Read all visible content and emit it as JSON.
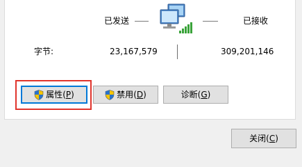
{
  "stats": {
    "sent_label": "已发送",
    "received_label": "已接收",
    "bytes_label": "字节:",
    "bytes_sent": "23,167,579",
    "bytes_received": "309,201,146"
  },
  "buttons": {
    "properties": {
      "label": "属性",
      "paren_open": "(",
      "accel": "P",
      "paren_close": ")"
    },
    "disable": {
      "label": "禁用",
      "paren_open": "(",
      "accel": "D",
      "paren_close": ")"
    },
    "diagnose": {
      "label": "诊断",
      "paren_open": "(",
      "accel": "G",
      "paren_close": ")"
    },
    "close": {
      "label": "关闭",
      "paren_open": "(",
      "accel": "C",
      "paren_close": ")"
    }
  },
  "icons": {
    "network": "network-activity-icon",
    "shield": "uac-shield-icon"
  },
  "colors": {
    "highlight": "#e0342c",
    "focus": "#0078d7",
    "signal": "#3aa33a"
  }
}
